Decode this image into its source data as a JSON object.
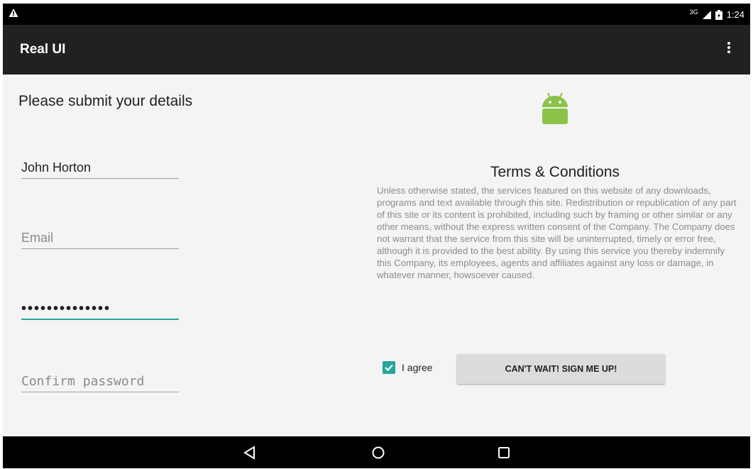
{
  "status_bar": {
    "warning_icon": "warning-triangle-icon",
    "network": "3G",
    "time": "1:24"
  },
  "app_bar": {
    "title": "Real UI",
    "menu_icon": "overflow-menu-icon"
  },
  "form": {
    "heading": "Please submit your details",
    "name_value": "John Horton",
    "email_placeholder": "Email",
    "password_value": "••••••••••••••",
    "confirm_placeholder": "Confirm password"
  },
  "terms": {
    "logo_icon": "android-logo-icon",
    "title": "Terms & Conditions",
    "body": "Unless otherwise stated, the services featured on this website  of any downloads, programs and text available through this site. Redistribution or republication of any part of this site or its content is prohibited, including such by framing or other similar or any other means, without the express written consent of the Company. The Company does not warrant that the service from this site will be uninterrupted, timely or error free, although it is provided to the best ability. By using this service you thereby indemnify this Company, its employees, agents and affiliates against any loss or damage, in whatever manner, howsoever caused.",
    "agree_label": "I agree",
    "agree_checked": true,
    "signup_label": "CAN'T WAIT! SIGN ME UP!"
  },
  "nav_bar": {
    "back_icon": "back-triangle-icon",
    "home_icon": "home-circle-icon",
    "recents_icon": "recents-square-icon"
  },
  "colors": {
    "accent": "#26a69a",
    "app_bar": "#212121",
    "android_green": "#8bc34a",
    "button": "#dcdcdc"
  }
}
